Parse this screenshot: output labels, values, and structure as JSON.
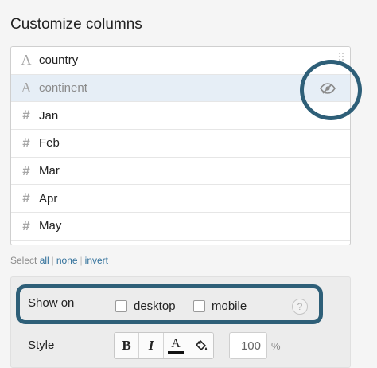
{
  "panel": {
    "title": "Customize columns"
  },
  "columns": [
    {
      "label": "country",
      "type": "text",
      "type_icon": "A"
    },
    {
      "label": "continent",
      "type": "text",
      "type_icon": "A",
      "hidden": true
    },
    {
      "label": "Jan",
      "type": "number",
      "type_icon": "#"
    },
    {
      "label": "Feb",
      "type": "number",
      "type_icon": "#"
    },
    {
      "label": "Mar",
      "type": "number",
      "type_icon": "#"
    },
    {
      "label": "Apr",
      "type": "number",
      "type_icon": "#"
    },
    {
      "label": "May",
      "type": "number",
      "type_icon": "#"
    }
  ],
  "select_controls": {
    "prefix": "Select",
    "all": "all",
    "none": "none",
    "invert": "invert"
  },
  "show_on": {
    "label": "Show on",
    "desktop_label": "desktop",
    "mobile_label": "mobile",
    "desktop_checked": false,
    "mobile_checked": false,
    "help_symbol": "?"
  },
  "style": {
    "label": "Style",
    "bold_label": "B",
    "italic_label": "I",
    "font_color_label": "A",
    "font_color": "#111111",
    "opacity_value": "100",
    "opacity_unit": "%"
  },
  "colors": {
    "highlight_ring": "#2e5f78",
    "link": "#2f6f9a",
    "hidden_row_bg": "#e6eef6"
  }
}
